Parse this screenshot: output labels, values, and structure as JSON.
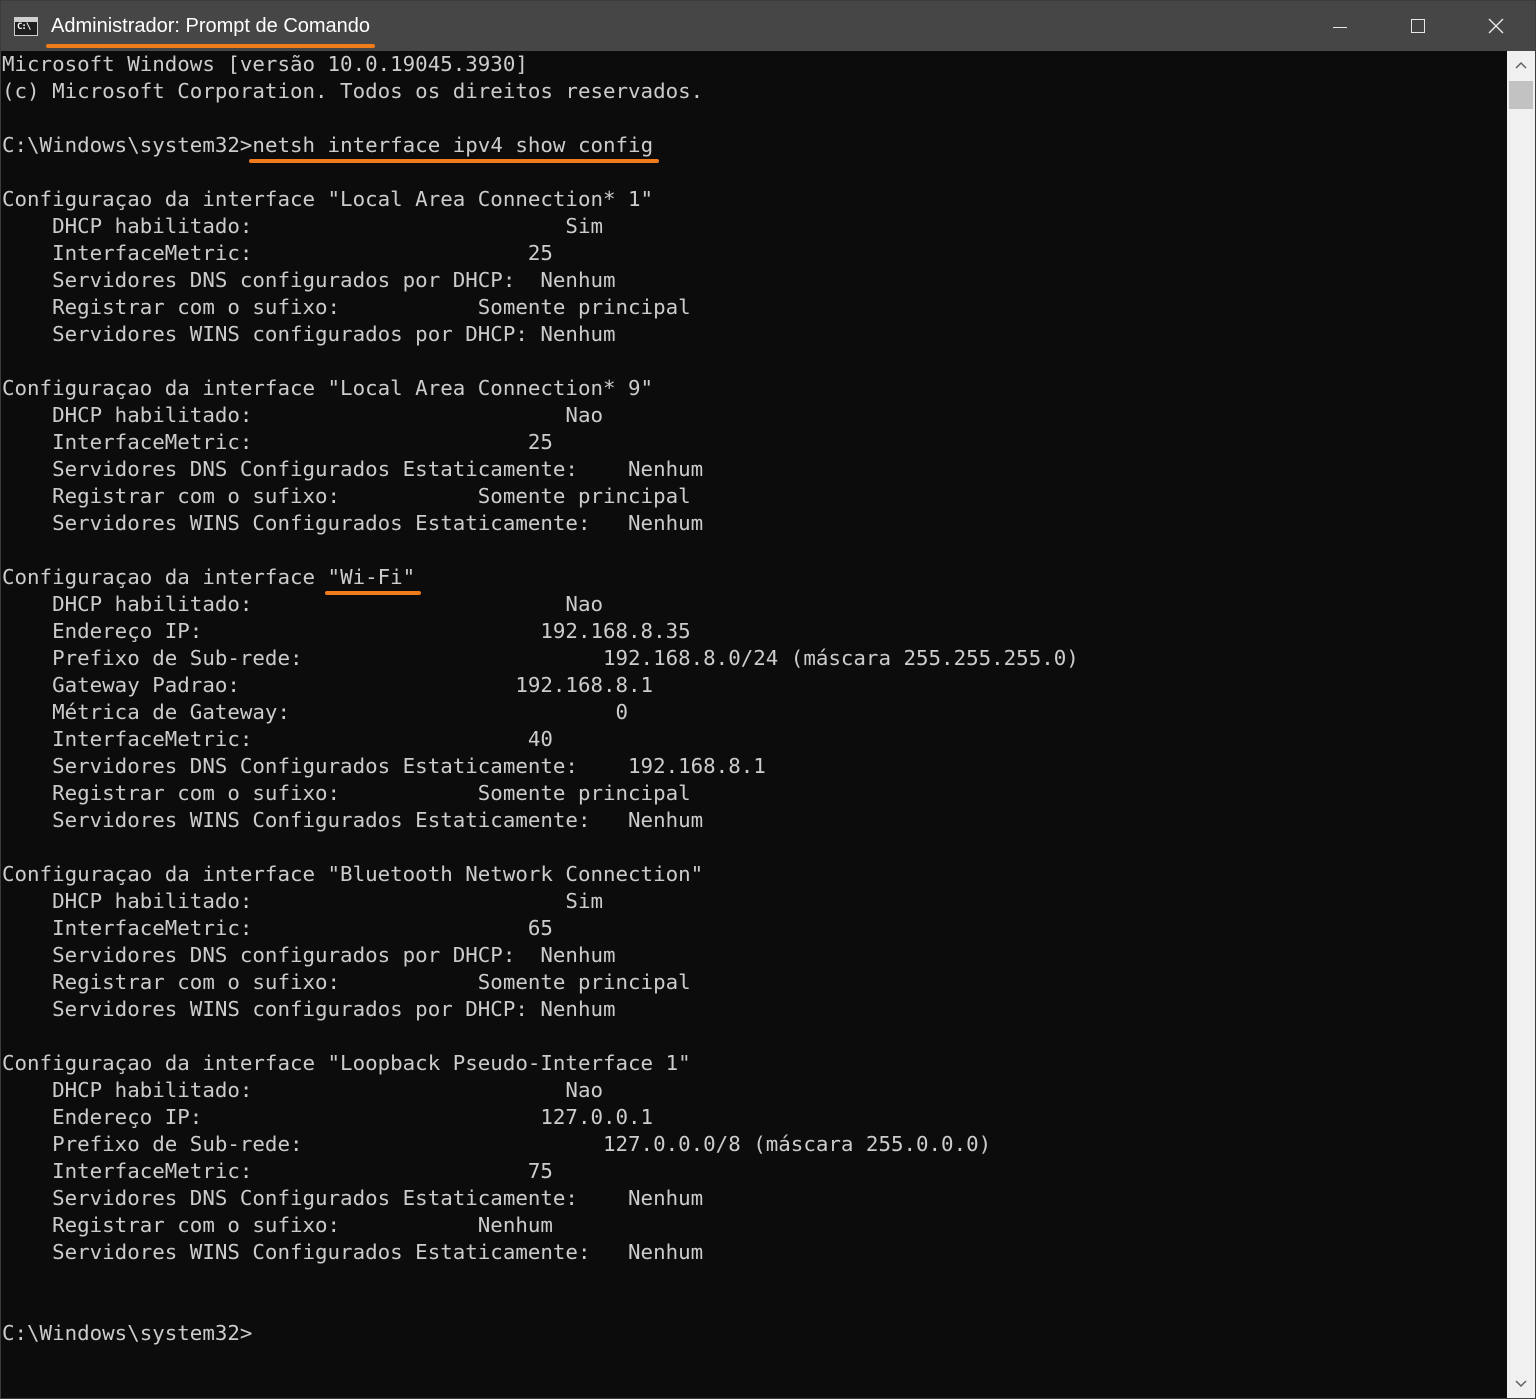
{
  "window": {
    "title": "Administrador: Prompt de Comando",
    "icon_label": "C:\\",
    "controls": [
      "minimize-icon",
      "maximize-icon",
      "close-icon"
    ],
    "accent": "#f07b1a"
  },
  "console": {
    "lines": [
      "Microsoft Windows [versão 10.0.19045.3930]",
      "(c) Microsoft Corporation. Todos os direitos reservados.",
      "",
      "C:\\Windows\\system32>netsh interface ipv4 show config",
      "",
      "Configuraçao da interface \"Local Area Connection* 1\"",
      "    DHCP habilitado:                         Sim",
      "    InterfaceMetric:                      25",
      "    Servidores DNS configurados por DHCP:  Nenhum",
      "    Registrar com o sufixo:           Somente principal",
      "    Servidores WINS configurados por DHCP: Nenhum",
      "",
      "Configuraçao da interface \"Local Area Connection* 9\"",
      "    DHCP habilitado:                         Nao",
      "    InterfaceMetric:                      25",
      "    Servidores DNS Configurados Estaticamente:    Nenhum",
      "    Registrar com o sufixo:           Somente principal",
      "    Servidores WINS Configurados Estaticamente:   Nenhum",
      "",
      "Configuraçao da interface \"Wi-Fi\"",
      "    DHCP habilitado:                         Nao",
      "    Endereço IP:                           192.168.8.35",
      "    Prefixo de Sub-rede:                        192.168.8.0/24 (máscara 255.255.255.0)",
      "    Gateway Padrao:                      192.168.8.1",
      "    Métrica de Gateway:                          0",
      "    InterfaceMetric:                      40",
      "    Servidores DNS Configurados Estaticamente:    192.168.8.1",
      "    Registrar com o sufixo:           Somente principal",
      "    Servidores WINS Configurados Estaticamente:   Nenhum",
      "",
      "Configuraçao da interface \"Bluetooth Network Connection\"",
      "    DHCP habilitado:                         Sim",
      "    InterfaceMetric:                      65",
      "    Servidores DNS configurados por DHCP:  Nenhum",
      "    Registrar com o sufixo:           Somente principal",
      "    Servidores WINS configurados por DHCP: Nenhum",
      "",
      "Configuraçao da interface \"Loopback Pseudo-Interface 1\"",
      "    DHCP habilitado:                         Nao",
      "    Endereço IP:                           127.0.0.1",
      "    Prefixo de Sub-rede:                        127.0.0.0/8 (máscara 255.0.0.0)",
      "    InterfaceMetric:                      75",
      "    Servidores DNS Configurados Estaticamente:    Nenhum",
      "    Registrar com o sufixo:           Nenhum",
      "    Servidores WINS Configurados Estaticamente:   Nenhum",
      "",
      "",
      "C:\\Windows\\system32>"
    ],
    "highlights": [
      {
        "line": 3,
        "text": "netsh interface ipv4 show config"
      },
      {
        "line": 19,
        "text": "\"Wi-Fi\""
      }
    ]
  }
}
